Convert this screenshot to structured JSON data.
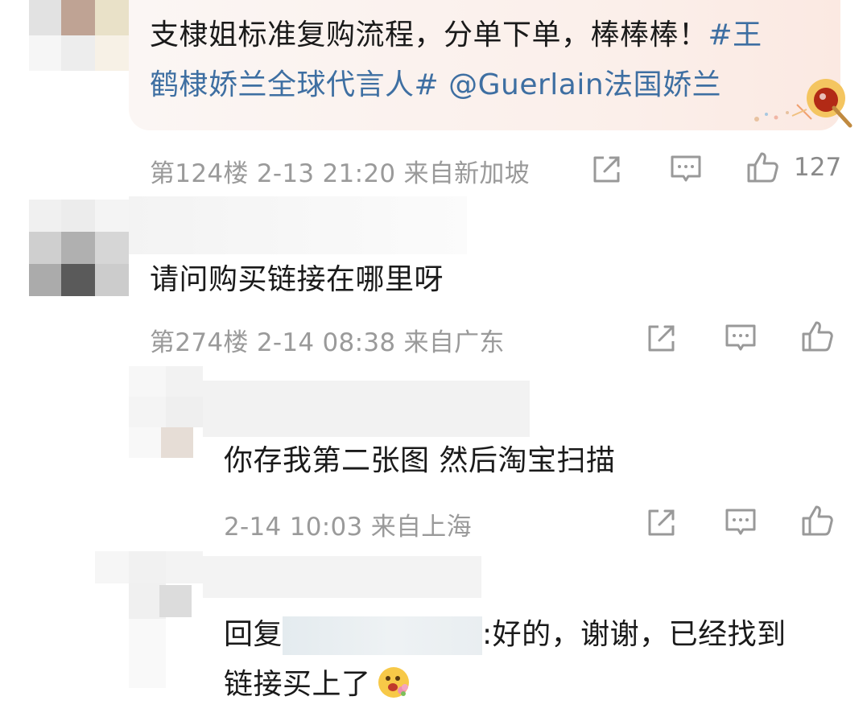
{
  "comments": [
    {
      "text_line1": "支棣姐标准复购流程，分单下单，棒棒棒！",
      "topic_part1": "#王",
      "topic_part2": "鹤棣娇兰全球代言人#",
      "mention": "@Guerlain法国娇兰",
      "meta": "第124楼  2-13 21:20  来自新加坡",
      "like_count": "127"
    },
    {
      "text": "请问购买链接在哪里呀",
      "meta": "第274楼  2-14 08:38  来自广东"
    }
  ],
  "replies": [
    {
      "text": "你存我第二张图 然后淘宝扫描",
      "meta": "2-14 10:03  来自上海"
    },
    {
      "prefix": "回复",
      "text_line1": ":好的，谢谢，已经找到",
      "text_line2": "链接买上了"
    }
  ],
  "icons": {
    "share": "share-icon",
    "comment": "comment-icon",
    "like": "thumb-up-icon",
    "emoji": "emoji-flower-icon",
    "sticker": "lollipop-sticker-icon"
  }
}
